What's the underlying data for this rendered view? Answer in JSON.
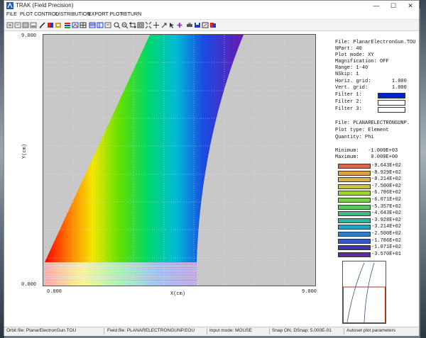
{
  "window": {
    "title": "TRAK (Field Precision)",
    "minimize": "—",
    "maximize": "☐",
    "close": "✕"
  },
  "menu": [
    "FILE",
    "PLOT CONTROL",
    "DISTRIBUTION",
    "EXPORT PLOT",
    "RETURN"
  ],
  "toolbar_icons": [
    "zoom-in-icon",
    "zoom-out-icon",
    "pan-icon",
    "refresh-icon",
    "pencil-icon",
    "palette-icon",
    "stop-icon",
    "color-bar-icon",
    "filter-icon",
    "grid-icon",
    "graph-icon",
    "table-icon",
    "magnify-icon",
    "search-icon",
    "expand-icon",
    "shrink-icon",
    "move-icon",
    "arrow-icon",
    "select-icon",
    "plus-icon",
    "print-icon",
    "save-icon",
    "export-icon",
    "copy-icon"
  ],
  "plot": {
    "y_max_label": "9.000",
    "y_min_label": "0.000",
    "x_min_label": "0.000",
    "x_max_label": "9.000",
    "x_axis_label": "X(cm)",
    "y_axis_label": "Y(cm)"
  },
  "info": {
    "file": "File: PlanarElectronGun.TOU",
    "npart": "NPart: 40",
    "plot_mode": "Plot mode: XY",
    "magnification": "Magnification: OFF",
    "range": "Range: 1-40",
    "nskip": "NSkip: 1",
    "horiz_grid": "Horiz. grid:       1.000",
    "vert_grid": "Vert. grid:        1.000",
    "filter1": "Filter 1:",
    "filter2": "Filter 2:",
    "filter3": "Filter 3:",
    "field_file": "File: PLANARELECTRONGUNP.",
    "plot_type": "Plot type: Element",
    "quantity": "Quantity: Phi",
    "minimum": "Minimum:   -1.000E+03",
    "maximum": "Maximum:    0.000E+00"
  },
  "legend": [
    {
      "value": "-9.643E+02",
      "color": "#d86b4a"
    },
    {
      "value": "-8.929E+02",
      "color": "#e0a04a"
    },
    {
      "value": "-8.214E+02",
      "color": "#d8b23c"
    },
    {
      "value": "-7.500E+02",
      "color": "#c9c635"
    },
    {
      "value": "-6.786E+02",
      "color": "#9fd23a"
    },
    {
      "value": "-6.071E+02",
      "color": "#7ed04b"
    },
    {
      "value": "-5.357E+02",
      "color": "#57c661"
    },
    {
      "value": "-4.643E+02",
      "color": "#39bf7e"
    },
    {
      "value": "-3.928E+02",
      "color": "#2cb6a4"
    },
    {
      "value": "-3.214E+02",
      "color": "#2a9fc2"
    },
    {
      "value": "-2.500E+02",
      "color": "#2c7fd0"
    },
    {
      "value": "-1.786E+02",
      "color": "#3156c8"
    },
    {
      "value": "-1.071E+02",
      "color": "#4433b8"
    },
    {
      "value": "-3.570E+01",
      "color": "#5a2aa8"
    }
  ],
  "colors": {
    "filter1": "#0022cc",
    "accent_border": "#b0361e"
  },
  "status": {
    "orbit_file": "Orbit file: PlanarElectronGun.TOU",
    "field_file": "Field file: PLANARELECTRONGUNP.EOU",
    "input_mode": "Input mode: MOUSE",
    "snap": "Snap ON, DSnap:   5.000E-01",
    "autoset": "Autoset plot parameters"
  }
}
